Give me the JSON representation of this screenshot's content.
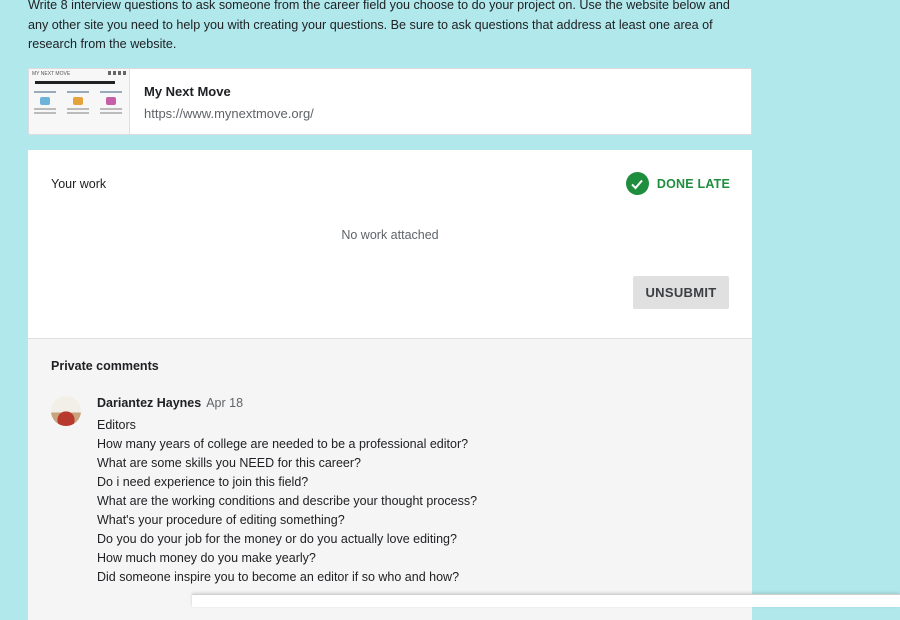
{
  "instructions": "Write 8 interview questions to ask someone from the career field you choose to do your project on. Use the website below and any other site you need to help you with creating your questions. Be sure to ask questions that address at least one area of research from the website.",
  "link": {
    "title": "My Next Move",
    "url": "https://www.mynextmove.org/",
    "thumbnail_icon": "website-thumbnail"
  },
  "work": {
    "title": "Your work",
    "status": "DONE LATE",
    "status_color": "#1e8e3e",
    "empty_text": "No work attached",
    "unsubmit_label": "UNSUBMIT"
  },
  "comments": {
    "title": "Private comments",
    "items": [
      {
        "author": "Dariantez Haynes",
        "date": "Apr 18",
        "lines": [
          "Editors",
          "How many years of college are needed to be a professional editor?",
          "What are some skills you NEED for this career?",
          "Do i need experience to join this field?",
          "What are the working conditions and describe your thought process?",
          "What's your procedure of editing something?",
          "Do you do your job for the money or do you actually love editing?",
          "How much money do you make yearly?",
          "Did someone inspire you to become an editor if so who and how?"
        ]
      }
    ]
  },
  "colors": {
    "page_background": "#b1e8ec",
    "card_background": "#ffffff",
    "comments_background": "#f5f5f5"
  }
}
